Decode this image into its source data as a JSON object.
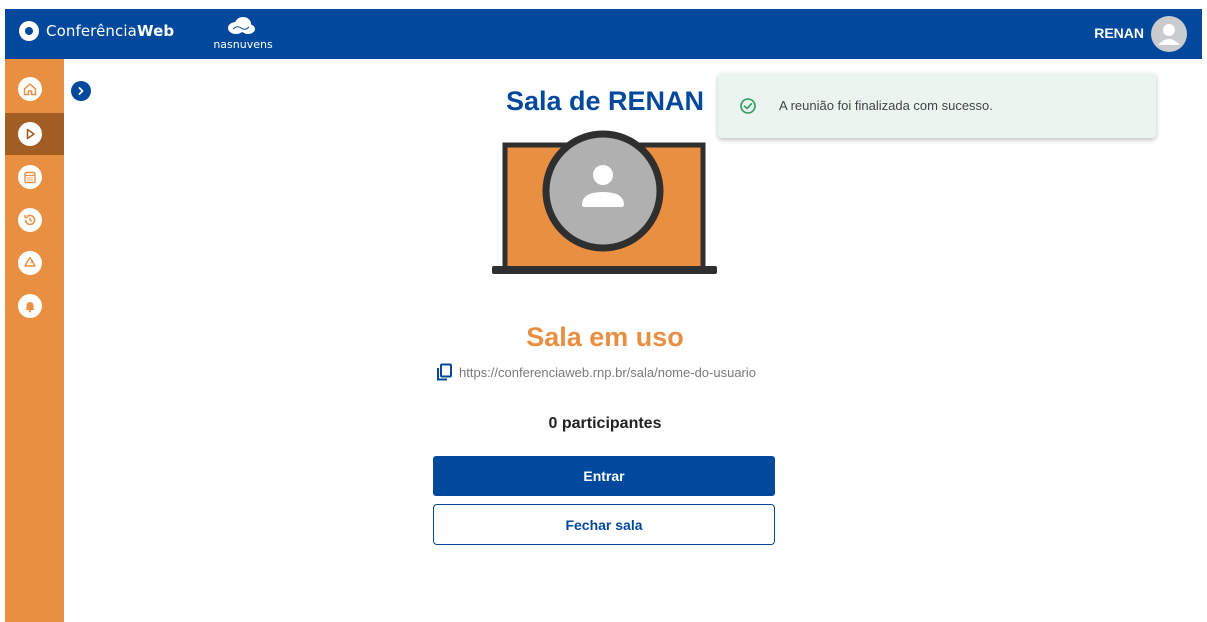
{
  "header": {
    "brand_light": "Conferência",
    "brand_bold": "Web",
    "partner": "nasnuvens",
    "user_name": "RENAN"
  },
  "sidebar": {
    "items": [
      {
        "name": "home",
        "icon": "home-icon",
        "active": false
      },
      {
        "name": "play",
        "icon": "play-icon",
        "active": true
      },
      {
        "name": "calendar",
        "icon": "calendar-icon",
        "active": false
      },
      {
        "name": "history",
        "icon": "history-icon",
        "active": false
      },
      {
        "name": "recycle",
        "icon": "recycle-icon",
        "active": false
      },
      {
        "name": "notifications",
        "icon": "bell-icon",
        "active": false
      }
    ]
  },
  "main": {
    "title": "Sala de RENAN",
    "status": "Sala em uso",
    "link": "https://conferenciaweb.rnp.br/sala/nome-do-usuario",
    "participants": "0 participantes",
    "enter_label": "Entrar",
    "close_label": "Fechar sala"
  },
  "toast": {
    "message": "A reunião foi finalizada com sucesso."
  },
  "colors": {
    "primary": "#02499d",
    "accent": "#e98f41",
    "sidebar_active": "#a25d22",
    "toast_bg": "#eaf5f0",
    "success": "#2e9a5e"
  }
}
